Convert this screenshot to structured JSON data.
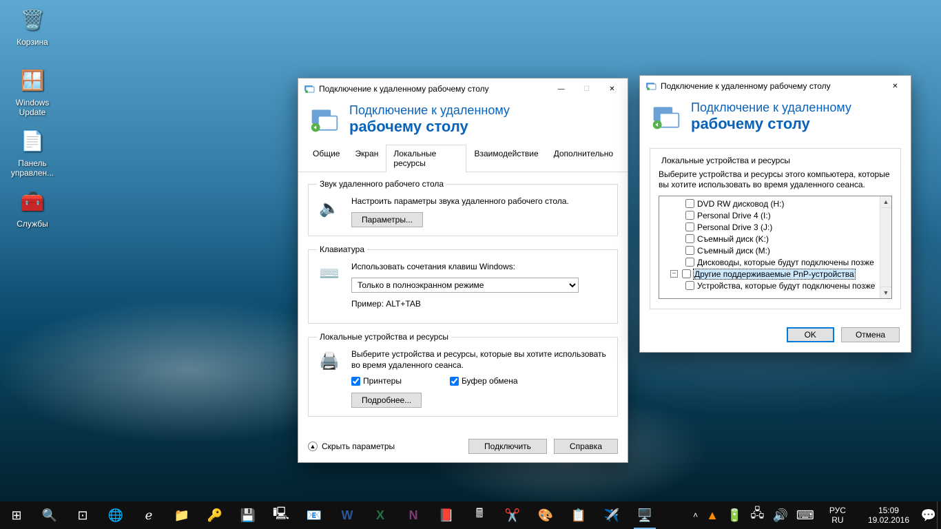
{
  "desktop_icons": [
    {
      "label": "Корзина",
      "glyph": "🗑️"
    },
    {
      "label": "Windows Update",
      "glyph": "🧩"
    },
    {
      "label": "Панель управлен...",
      "glyph": "📄"
    },
    {
      "label": "Службы",
      "glyph": "🧰"
    }
  ],
  "win1": {
    "title": "Подключение к удаленному рабочему столу",
    "banner_l1": "Подключение к удаленному",
    "banner_l2": "рабочему столу",
    "tabs": {
      "general": "Общие",
      "display": "Экран",
      "local": "Локальные ресурсы",
      "experience": "Взаимодействие",
      "advanced": "Дополнительно"
    },
    "sound": {
      "legend": "Звук удаленного рабочего стола",
      "desc": "Настроить параметры звука удаленного рабочего стола.",
      "button": "Параметры..."
    },
    "keyboard": {
      "legend": "Клавиатура",
      "desc": "Использовать сочетания клавиш Windows:",
      "option": "Только в полноэкранном режиме",
      "example": "Пример: ALT+TAB"
    },
    "local": {
      "legend": "Локальные устройства и ресурсы",
      "desc": "Выберите устройства и ресурсы, которые вы хотите использовать во время удаленного сеанса.",
      "printers": "Принтеры",
      "clipboard": "Буфер обмена",
      "more": "Подробнее..."
    },
    "hide": "Скрыть параметры",
    "connect": "Подключить",
    "help": "Справка"
  },
  "win2": {
    "title": "Подключение к удаленному рабочему столу",
    "banner_l1": "Подключение к удаленному",
    "banner_l2": "рабочему столу",
    "group_title": "Локальные устройства и ресурсы",
    "desc": "Выберите устройства и ресурсы этого компьютера, которые вы хотите использовать во время удаленного сеанса.",
    "tree": [
      "DVD RW дисковод (H:)",
      "Personal Drive 4 (I:)",
      "Personal Drive 3 (J:)",
      "Съемный диск (K:)",
      "Съемный диск (M:)",
      "Дисководы, которые будут подключены позже"
    ],
    "pnp": "Другие поддерживаемые PnP-устройства",
    "pnp_child": "Устройства, которые будут подключены позже",
    "ok": "OK",
    "cancel": "Отмена"
  },
  "tray": {
    "lang1": "РУС",
    "lang2": "RU",
    "time": "15:09",
    "date": "19.02.2016"
  }
}
